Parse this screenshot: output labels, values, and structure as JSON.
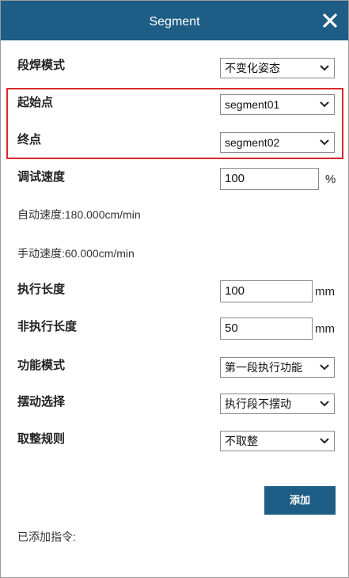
{
  "dialog": {
    "title": "Segment"
  },
  "fields": {
    "weld_mode": {
      "label": "段焊模式",
      "value": "不变化姿态"
    },
    "start_point": {
      "label": "起始点",
      "value": "segment01"
    },
    "end_point": {
      "label": "终点",
      "value": "segment02"
    },
    "debug_speed": {
      "label": "调试速度",
      "value": "100",
      "unit": "%"
    },
    "auto_speed": "自动速度:180.000cm/min",
    "manual_speed": "手动速度:60.000cm/min",
    "exec_length": {
      "label": "执行长度",
      "value": "100",
      "unit": "mm"
    },
    "non_exec_length": {
      "label": "非执行长度",
      "value": "50",
      "unit": "mm"
    },
    "function_mode": {
      "label": "功能模式",
      "value": "第一段执行功能"
    },
    "swing_select": {
      "label": "摆动选择",
      "value": "执行段不摆动"
    },
    "rounding_rule": {
      "label": "取整规则",
      "value": "不取整"
    }
  },
  "actions": {
    "add_label": "添加"
  },
  "added_instructions": {
    "label": "已添加指令:"
  },
  "colors": {
    "titlebar": "#1e5e86",
    "highlight": "#d72a2a",
    "button": "#1e5e86"
  },
  "icons": {
    "close": "close-icon",
    "dropdown": "chevron-down-icon"
  }
}
